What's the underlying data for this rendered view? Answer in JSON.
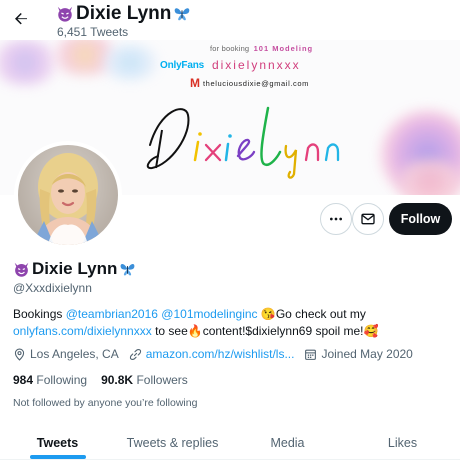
{
  "header": {
    "name": "Dixie Lynn",
    "tweet_count": "6,451 Tweets"
  },
  "banner": {
    "booking_text": "for booking",
    "agency": "101 Modeling",
    "onlyfans_logo": "OnlyFans",
    "onlyfans_handle": "dixielynnxxx",
    "email": "theluciousdixie@gmail.com",
    "script_name": "Dixie Lynn"
  },
  "actions": {
    "follow_label": "Follow"
  },
  "profile": {
    "name": "Dixie Lynn",
    "handle": "@Xxxdixielynn",
    "bio": {
      "t1": "Bookings ",
      "mention1": "@teambrian2016",
      "t2": " ",
      "mention2": "@101modelinginc",
      "t3": " 😘Go check out my ",
      "link1": "onlyfans.com/dixielynnxxx",
      "t4": " to see🔥content!$dixielynn69 spoil me!🥰"
    },
    "location": "Los Angeles, CA",
    "website": "amazon.com/hz/wishlist/ls...",
    "joined": "Joined May 2020",
    "following_count": "984",
    "following_label": "Following",
    "followers_count": "90.8K",
    "followers_label": "Followers",
    "not_followed": "Not followed by anyone you’re following"
  },
  "tabs": [
    {
      "label": "Tweets",
      "active": true
    },
    {
      "label": "Tweets & replies",
      "active": false
    },
    {
      "label": "Media",
      "active": false
    },
    {
      "label": "Likes",
      "active": false
    }
  ],
  "colors": {
    "accent": "#1d9bf0",
    "text": "#0f1419",
    "secondary": "#536471",
    "follow_bg": "#0f1419"
  }
}
